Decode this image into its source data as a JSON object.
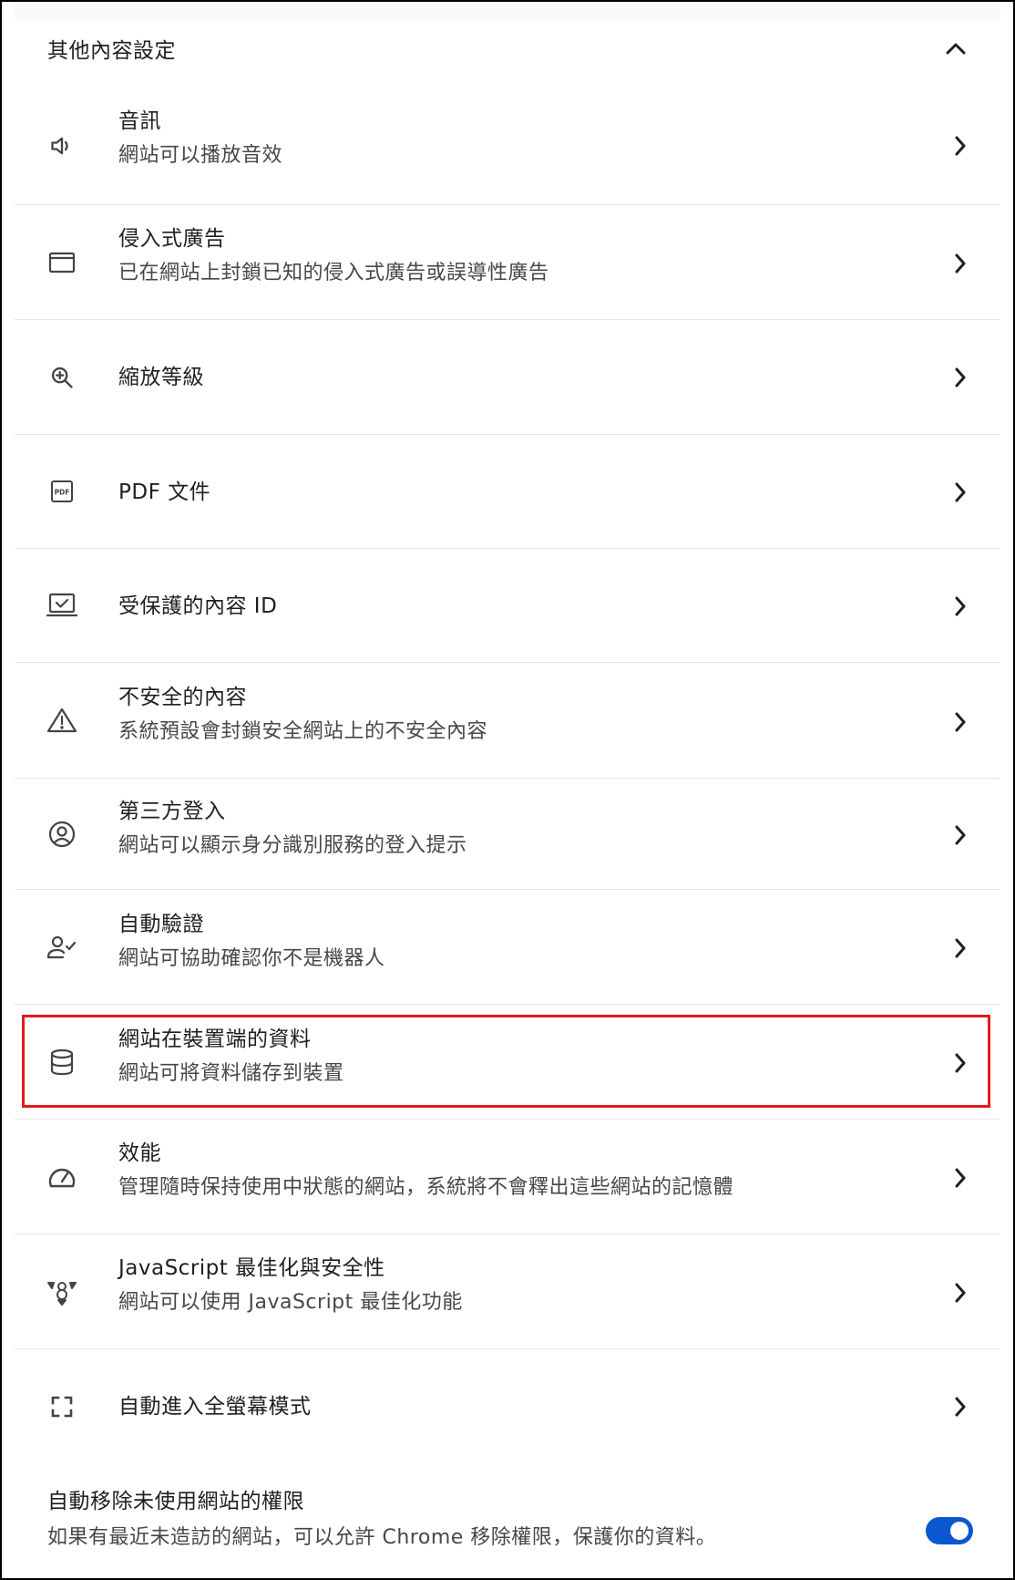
{
  "section": {
    "title": "其他內容設定",
    "collapse_icon": "chevron-up-icon"
  },
  "items": [
    {
      "id": "sound",
      "title": "音訊",
      "subtitle": "網站可以播放音效",
      "icon": "volume-icon"
    },
    {
      "id": "intrusive-ads",
      "title": "侵入式廣告",
      "subtitle": "已在網站上封鎖已知的侵入式廣告或誤導性廣告",
      "icon": "window-icon"
    },
    {
      "id": "zoom-levels",
      "title": "縮放等級",
      "subtitle": "",
      "icon": "zoom-in-icon"
    },
    {
      "id": "pdf-documents",
      "title": "PDF 文件",
      "subtitle": "",
      "icon": "pdf-icon"
    },
    {
      "id": "protected-content",
      "title": "受保護的內容 ID",
      "subtitle": "",
      "icon": "laptop-check-icon"
    },
    {
      "id": "insecure-content",
      "title": "不安全的內容",
      "subtitle": "系統預設會封鎖安全網站上的不安全內容",
      "icon": "warning-icon"
    },
    {
      "id": "third-party-sign-in",
      "title": "第三方登入",
      "subtitle": "網站可以顯示身分識別服務的登入提示",
      "icon": "account-circle-icon"
    },
    {
      "id": "auto-verify",
      "title": "自動驗證",
      "subtitle": "網站可協助確認你不是機器人",
      "icon": "person-check-icon"
    },
    {
      "id": "on-device-site-data",
      "title": "網站在裝置端的資料",
      "subtitle": "網站可將資料儲存到裝置",
      "icon": "database-icon"
    },
    {
      "id": "performance",
      "title": "效能",
      "subtitle": "管理隨時保持使用中狀態的網站，系統將不會釋出這些網站的記憶體",
      "icon": "speedometer-icon"
    },
    {
      "id": "v8-optimizer",
      "title": "JavaScript 最佳化與安全性",
      "subtitle": "網站可以使用 JavaScript 最佳化功能",
      "icon": "v8-icon"
    },
    {
      "id": "auto-fullscreen",
      "title": "自動進入全螢幕模式",
      "subtitle": "",
      "icon": "fullscreen-icon"
    }
  ],
  "auto_revoke": {
    "title": "自動移除未使用網站的權限",
    "subtitle": "如果有最近未造訪的網站，可以允許 Chrome 移除權限，保護你的資料。",
    "enabled": true
  },
  "colors": {
    "accent": "#0b57d0",
    "highlight_border": "#e0191c",
    "text_primary": "#1f1f1f",
    "text_secondary": "#474747",
    "divider": "#e6e6e6"
  },
  "highlighted_item": "on-device-site-data"
}
